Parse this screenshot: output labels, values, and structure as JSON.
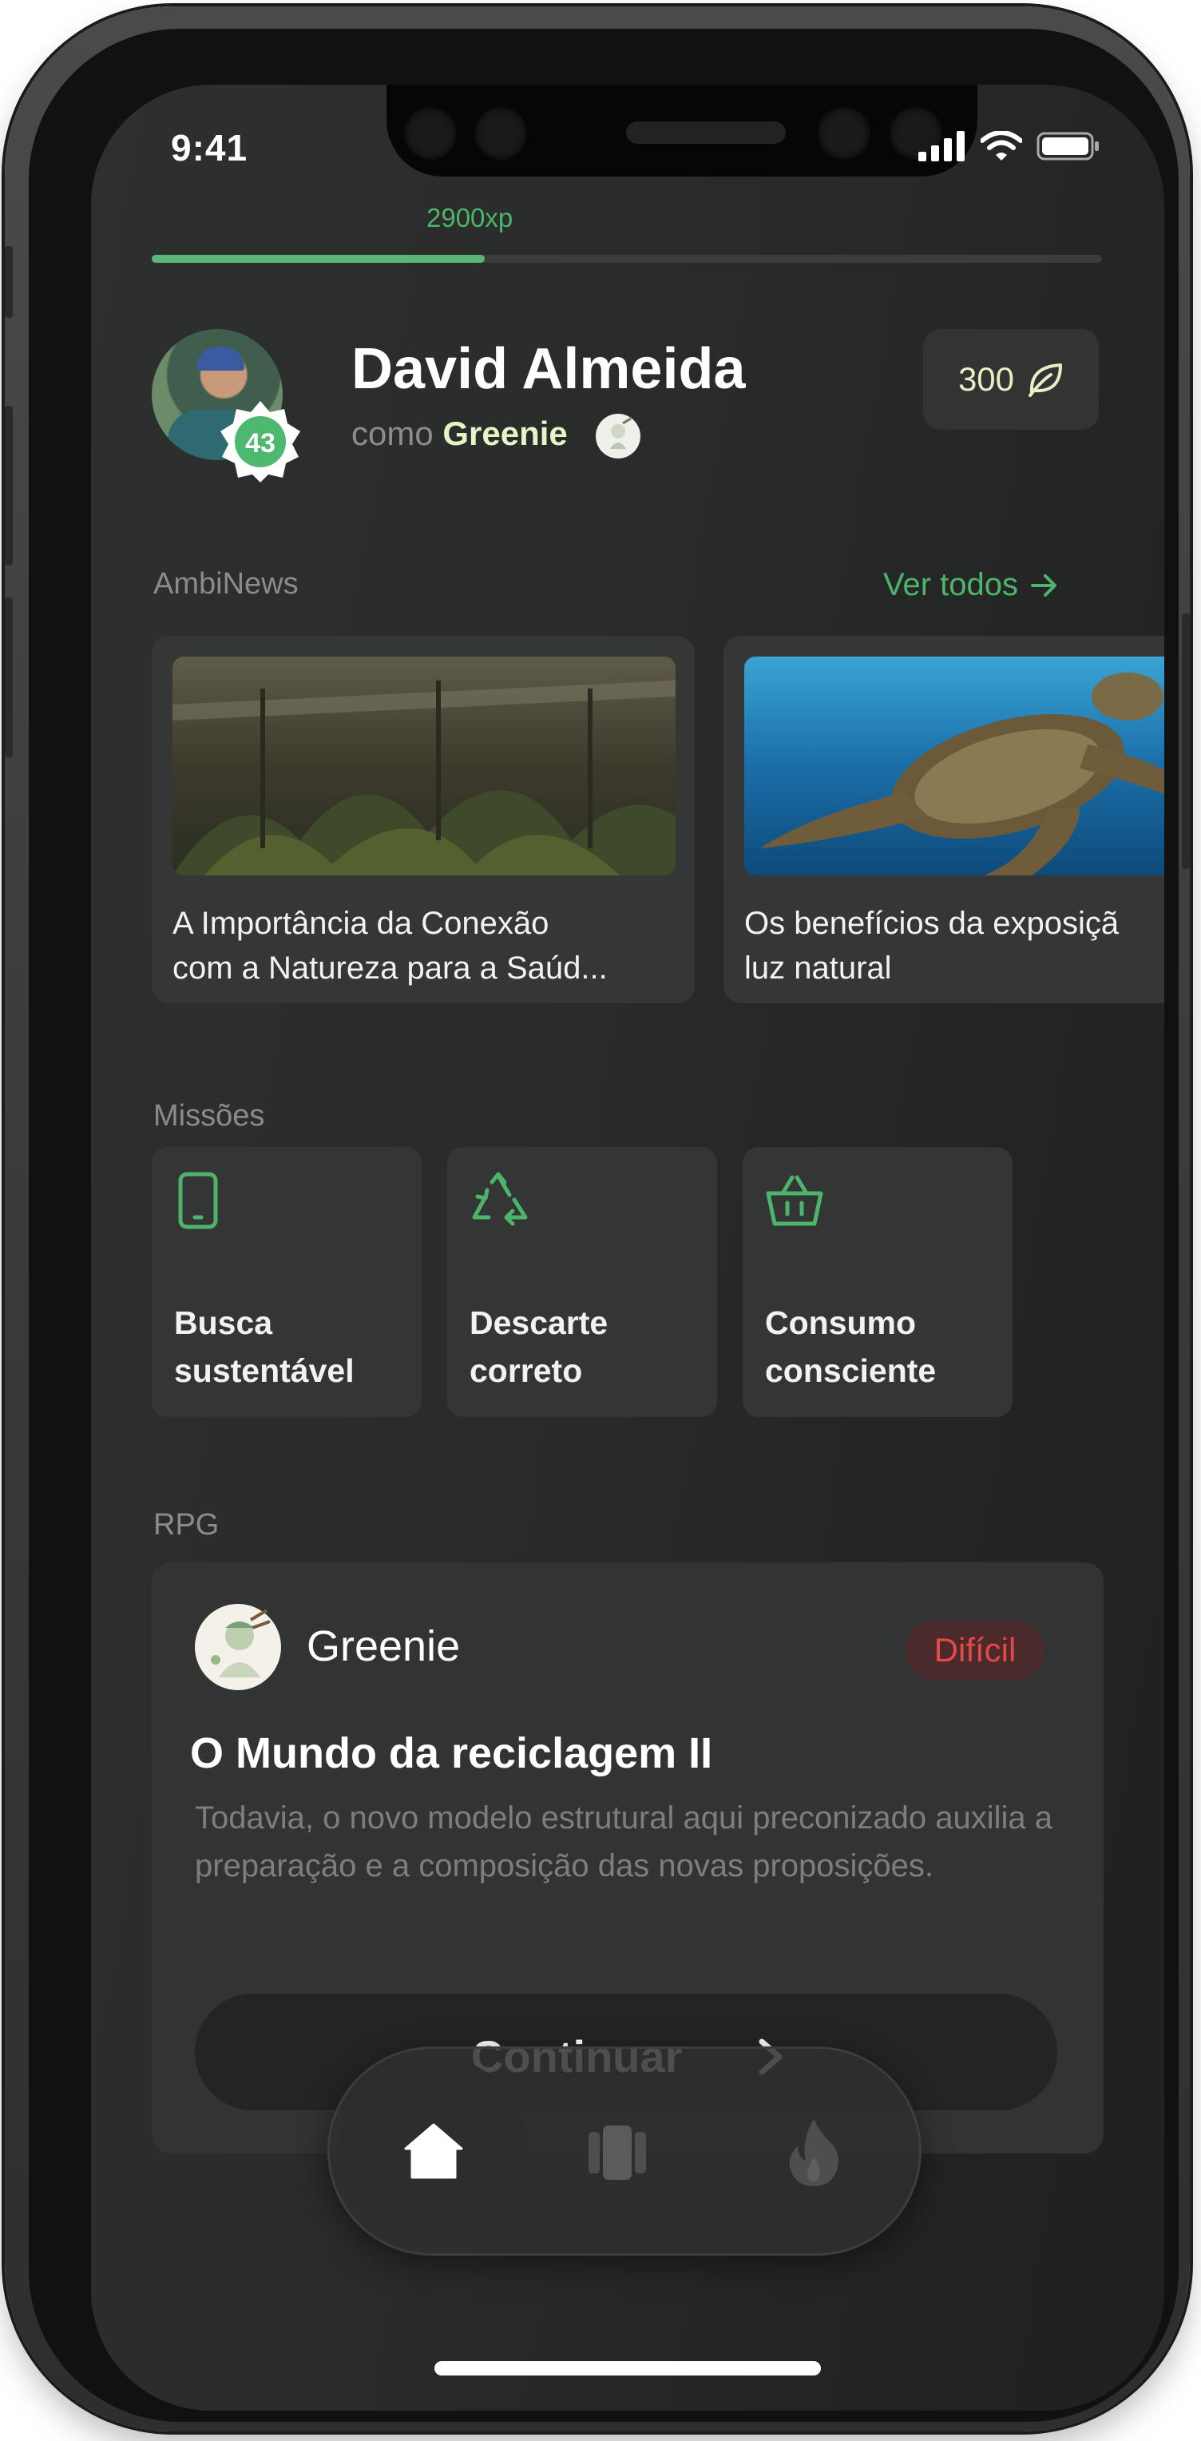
{
  "status": {
    "time": "9:41"
  },
  "xp": {
    "label": "2900xp",
    "progress": 0.35
  },
  "profile": {
    "name": "David Almeida",
    "role_prefix": "como",
    "role": "Greenie",
    "level": "43",
    "coins": "300"
  },
  "news": {
    "title": "AmbiNews",
    "see_all": "Ver todos",
    "items": [
      {
        "title": "A Importância da Conexão\ncom a Natureza para a Saúd...",
        "image": "forest-greenhouse"
      },
      {
        "title": "Os benefícios da exposiçã\nluz natural",
        "image": "sea-turtle"
      }
    ]
  },
  "missions": {
    "title": "Missões",
    "items": [
      {
        "label": "Busca\nsustentável",
        "icon": "phone-icon"
      },
      {
        "label": "Descarte\ncorreto",
        "icon": "recycle-icon"
      },
      {
        "label": "Consumo\nconsciente",
        "icon": "basket-icon"
      }
    ]
  },
  "rpg": {
    "title": "RPG",
    "character": "Greenie",
    "difficulty": "Difícil",
    "quest_title": "O Mundo da reciclagem II",
    "description": "Todavia, o novo modelo estrutural aqui preconizado auxilia a preparação e a composição das novas proposições.",
    "continue_label": "Continuar"
  },
  "nav": {
    "items": [
      {
        "icon": "home-icon",
        "active": true
      },
      {
        "icon": "cards-icon",
        "active": false
      },
      {
        "icon": "fire-icon",
        "active": false
      }
    ]
  },
  "colors": {
    "accent": "#5bb679",
    "coin_text": "#e6f0c6",
    "difficulty": "#e64848",
    "background": "#2a2b2b"
  }
}
